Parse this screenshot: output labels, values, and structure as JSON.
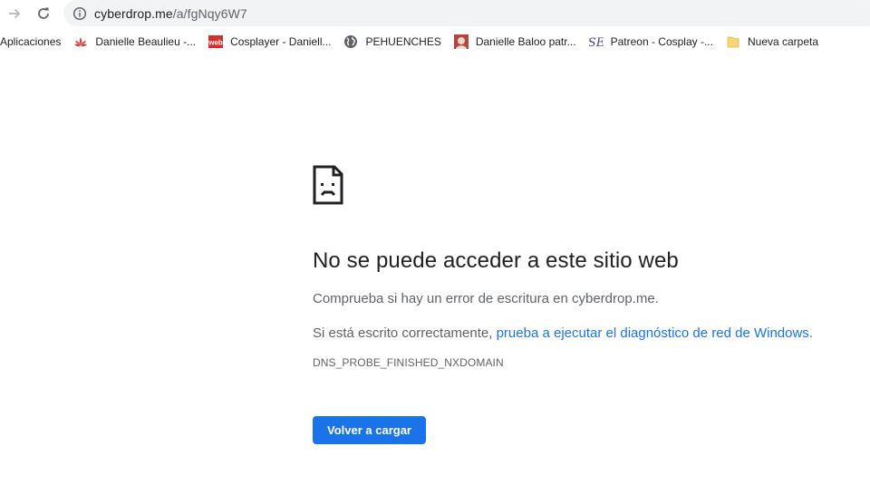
{
  "toolbar": {
    "url_host": "cyberdrop.me",
    "url_path": "/a/fgNqy6W7"
  },
  "icons": {
    "forward": "forward-arrow-icon",
    "reload": "reload-icon",
    "info": "info-icon",
    "error": "sad-page-icon"
  },
  "bookmarks": [
    {
      "label": "Aplicaciones",
      "icon": "apps-icon"
    },
    {
      "label": "Danielle Beaulieu -...",
      "icon": "lotus-icon"
    },
    {
      "label": "Cosplayer - Daniell...",
      "icon": "web-icon"
    },
    {
      "label": "PEHUENCHES",
      "icon": "globe-icon"
    },
    {
      "label": "Danielle Baloo patr...",
      "icon": "avatar-icon"
    },
    {
      "label": "Patreon - Cosplay -...",
      "icon": "se-icon"
    },
    {
      "label": "Nueva carpeta",
      "icon": "folder-icon"
    }
  ],
  "error": {
    "heading": "No se puede acceder a este sitio web",
    "line1": "Comprueba si hay un error de escritura en cyberdrop.me.",
    "line2_prefix": "Si está escrito correctamente, ",
    "line2_link": "prueba a ejecutar el diagnóstico de red de Windows",
    "line2_suffix": ".",
    "code": "DNS_PROBE_FINISHED_NXDOMAIN",
    "reload_label": "Volver a cargar"
  },
  "colors": {
    "accent": "#1a73e8",
    "text_primary": "#202124",
    "text_secondary": "#5f6368",
    "omnibox_bg": "#f1f3f4"
  }
}
